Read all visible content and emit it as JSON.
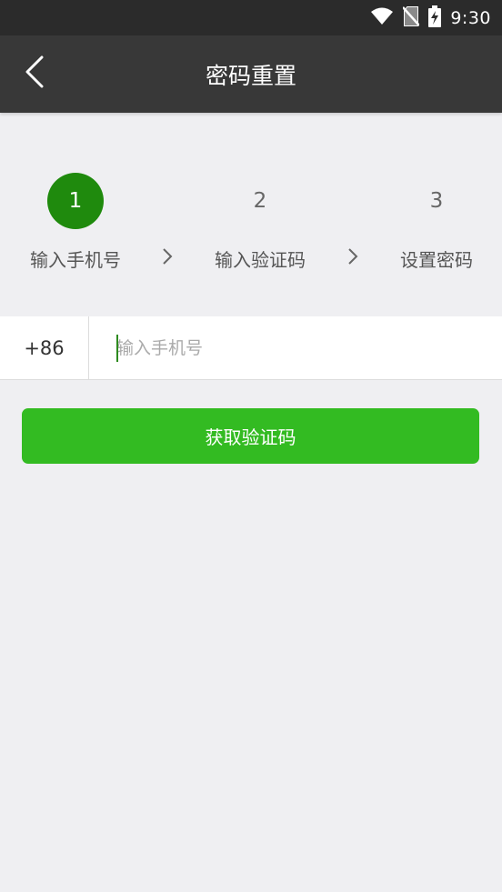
{
  "status_bar": {
    "time": "9:30",
    "icons": [
      "wifi-icon",
      "no-sim-icon",
      "battery-charging-icon"
    ]
  },
  "header": {
    "title": "密码重置",
    "back_icon": "chevron-left-icon"
  },
  "steps": [
    {
      "number": "1",
      "label": "输入手机号",
      "active": true
    },
    {
      "number": "2",
      "label": "输入验证码",
      "active": false
    },
    {
      "number": "3",
      "label": "设置密码",
      "active": false
    }
  ],
  "phone_form": {
    "country_code": "+86",
    "placeholder": "输入手机号",
    "value": ""
  },
  "actions": {
    "get_code_label": "获取验证码"
  },
  "colors": {
    "status_bar_bg": "#2b2b2b",
    "title_bar_bg": "#383838",
    "active_step": "#1f8a0d",
    "button_bg": "#33bb22",
    "page_bg": "#efeff2"
  }
}
